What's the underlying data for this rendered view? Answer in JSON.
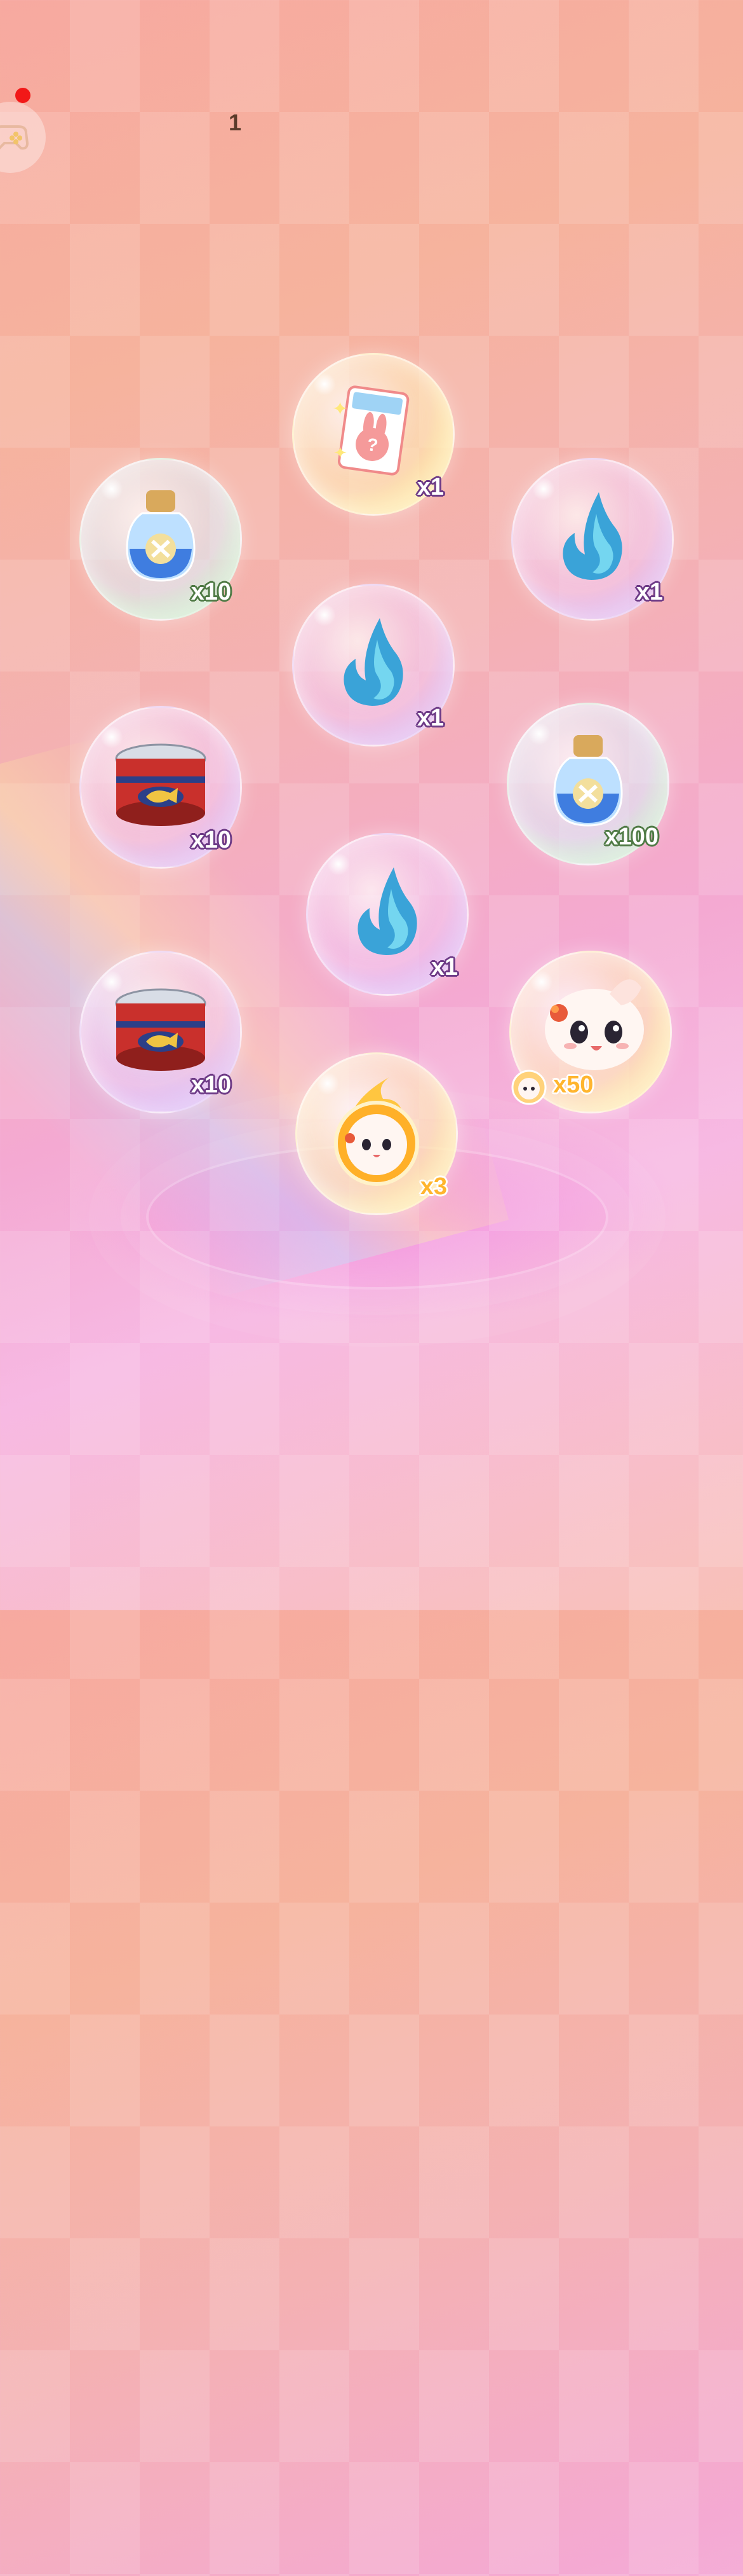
{
  "hud": {
    "counter": "1"
  },
  "icons": {
    "notification_dot": "red-dot",
    "controller": "gamepad-icon"
  },
  "rewards": [
    {
      "name": "mystery-card",
      "icon": "bunny-card-icon",
      "quantity": "x1"
    },
    {
      "name": "crystal-bottle",
      "icon": "star-bottle-icon",
      "quantity": "x10"
    },
    {
      "name": "blue-flame",
      "icon": "blue-flame-icon",
      "quantity": "x1"
    },
    {
      "name": "blue-flame",
      "icon": "blue-flame-icon",
      "quantity": "x1"
    },
    {
      "name": "food-can",
      "icon": "fish-can-icon",
      "quantity": "x10"
    },
    {
      "name": "crystal-bottle",
      "icon": "star-bottle-icon",
      "quantity": "x100"
    },
    {
      "name": "blue-flame",
      "icon": "blue-flame-icon",
      "quantity": "x1"
    },
    {
      "name": "food-can",
      "icon": "fish-can-icon",
      "quantity": "x10"
    },
    {
      "name": "bunny-avatar",
      "icon": "bunny-avatar-icon",
      "quantity": "x50"
    },
    {
      "name": "fire-token",
      "icon": "bunny-fire-token-icon",
      "quantity": "x3"
    }
  ],
  "colors": {
    "background_top": "#f7a9a0",
    "background_bottom": "#f7b9e3",
    "qty_outline": "#6d3a86",
    "gold": "#ffb52e"
  }
}
